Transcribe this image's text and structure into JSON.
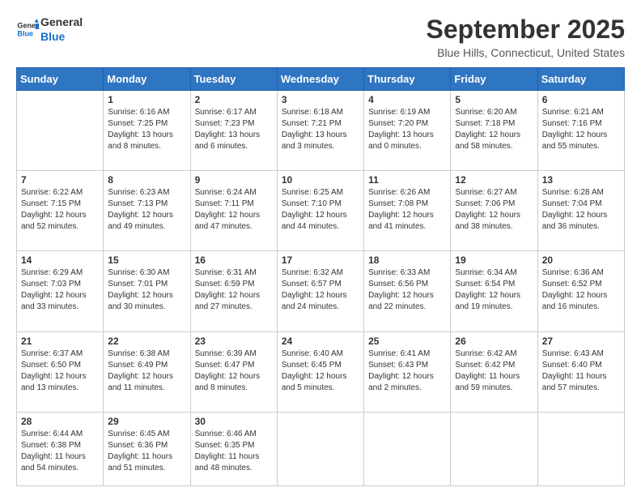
{
  "header": {
    "logo_line1": "General",
    "logo_line2": "Blue",
    "month_title": "September 2025",
    "location": "Blue Hills, Connecticut, United States"
  },
  "weekdays": [
    "Sunday",
    "Monday",
    "Tuesday",
    "Wednesday",
    "Thursday",
    "Friday",
    "Saturday"
  ],
  "weeks": [
    [
      {
        "num": "",
        "sunrise": "",
        "sunset": "",
        "daylight": ""
      },
      {
        "num": "1",
        "sunrise": "Sunrise: 6:16 AM",
        "sunset": "Sunset: 7:25 PM",
        "daylight": "Daylight: 13 hours and 8 minutes."
      },
      {
        "num": "2",
        "sunrise": "Sunrise: 6:17 AM",
        "sunset": "Sunset: 7:23 PM",
        "daylight": "Daylight: 13 hours and 6 minutes."
      },
      {
        "num": "3",
        "sunrise": "Sunrise: 6:18 AM",
        "sunset": "Sunset: 7:21 PM",
        "daylight": "Daylight: 13 hours and 3 minutes."
      },
      {
        "num": "4",
        "sunrise": "Sunrise: 6:19 AM",
        "sunset": "Sunset: 7:20 PM",
        "daylight": "Daylight: 13 hours and 0 minutes."
      },
      {
        "num": "5",
        "sunrise": "Sunrise: 6:20 AM",
        "sunset": "Sunset: 7:18 PM",
        "daylight": "Daylight: 12 hours and 58 minutes."
      },
      {
        "num": "6",
        "sunrise": "Sunrise: 6:21 AM",
        "sunset": "Sunset: 7:16 PM",
        "daylight": "Daylight: 12 hours and 55 minutes."
      }
    ],
    [
      {
        "num": "7",
        "sunrise": "Sunrise: 6:22 AM",
        "sunset": "Sunset: 7:15 PM",
        "daylight": "Daylight: 12 hours and 52 minutes."
      },
      {
        "num": "8",
        "sunrise": "Sunrise: 6:23 AM",
        "sunset": "Sunset: 7:13 PM",
        "daylight": "Daylight: 12 hours and 49 minutes."
      },
      {
        "num": "9",
        "sunrise": "Sunrise: 6:24 AM",
        "sunset": "Sunset: 7:11 PM",
        "daylight": "Daylight: 12 hours and 47 minutes."
      },
      {
        "num": "10",
        "sunrise": "Sunrise: 6:25 AM",
        "sunset": "Sunset: 7:10 PM",
        "daylight": "Daylight: 12 hours and 44 minutes."
      },
      {
        "num": "11",
        "sunrise": "Sunrise: 6:26 AM",
        "sunset": "Sunset: 7:08 PM",
        "daylight": "Daylight: 12 hours and 41 minutes."
      },
      {
        "num": "12",
        "sunrise": "Sunrise: 6:27 AM",
        "sunset": "Sunset: 7:06 PM",
        "daylight": "Daylight: 12 hours and 38 minutes."
      },
      {
        "num": "13",
        "sunrise": "Sunrise: 6:28 AM",
        "sunset": "Sunset: 7:04 PM",
        "daylight": "Daylight: 12 hours and 36 minutes."
      }
    ],
    [
      {
        "num": "14",
        "sunrise": "Sunrise: 6:29 AM",
        "sunset": "Sunset: 7:03 PM",
        "daylight": "Daylight: 12 hours and 33 minutes."
      },
      {
        "num": "15",
        "sunrise": "Sunrise: 6:30 AM",
        "sunset": "Sunset: 7:01 PM",
        "daylight": "Daylight: 12 hours and 30 minutes."
      },
      {
        "num": "16",
        "sunrise": "Sunrise: 6:31 AM",
        "sunset": "Sunset: 6:59 PM",
        "daylight": "Daylight: 12 hours and 27 minutes."
      },
      {
        "num": "17",
        "sunrise": "Sunrise: 6:32 AM",
        "sunset": "Sunset: 6:57 PM",
        "daylight": "Daylight: 12 hours and 24 minutes."
      },
      {
        "num": "18",
        "sunrise": "Sunrise: 6:33 AM",
        "sunset": "Sunset: 6:56 PM",
        "daylight": "Daylight: 12 hours and 22 minutes."
      },
      {
        "num": "19",
        "sunrise": "Sunrise: 6:34 AM",
        "sunset": "Sunset: 6:54 PM",
        "daylight": "Daylight: 12 hours and 19 minutes."
      },
      {
        "num": "20",
        "sunrise": "Sunrise: 6:36 AM",
        "sunset": "Sunset: 6:52 PM",
        "daylight": "Daylight: 12 hours and 16 minutes."
      }
    ],
    [
      {
        "num": "21",
        "sunrise": "Sunrise: 6:37 AM",
        "sunset": "Sunset: 6:50 PM",
        "daylight": "Daylight: 12 hours and 13 minutes."
      },
      {
        "num": "22",
        "sunrise": "Sunrise: 6:38 AM",
        "sunset": "Sunset: 6:49 PM",
        "daylight": "Daylight: 12 hours and 11 minutes."
      },
      {
        "num": "23",
        "sunrise": "Sunrise: 6:39 AM",
        "sunset": "Sunset: 6:47 PM",
        "daylight": "Daylight: 12 hours and 8 minutes."
      },
      {
        "num": "24",
        "sunrise": "Sunrise: 6:40 AM",
        "sunset": "Sunset: 6:45 PM",
        "daylight": "Daylight: 12 hours and 5 minutes."
      },
      {
        "num": "25",
        "sunrise": "Sunrise: 6:41 AM",
        "sunset": "Sunset: 6:43 PM",
        "daylight": "Daylight: 12 hours and 2 minutes."
      },
      {
        "num": "26",
        "sunrise": "Sunrise: 6:42 AM",
        "sunset": "Sunset: 6:42 PM",
        "daylight": "Daylight: 11 hours and 59 minutes."
      },
      {
        "num": "27",
        "sunrise": "Sunrise: 6:43 AM",
        "sunset": "Sunset: 6:40 PM",
        "daylight": "Daylight: 11 hours and 57 minutes."
      }
    ],
    [
      {
        "num": "28",
        "sunrise": "Sunrise: 6:44 AM",
        "sunset": "Sunset: 6:38 PM",
        "daylight": "Daylight: 11 hours and 54 minutes."
      },
      {
        "num": "29",
        "sunrise": "Sunrise: 6:45 AM",
        "sunset": "Sunset: 6:36 PM",
        "daylight": "Daylight: 11 hours and 51 minutes."
      },
      {
        "num": "30",
        "sunrise": "Sunrise: 6:46 AM",
        "sunset": "Sunset: 6:35 PM",
        "daylight": "Daylight: 11 hours and 48 minutes."
      },
      {
        "num": "",
        "sunrise": "",
        "sunset": "",
        "daylight": ""
      },
      {
        "num": "",
        "sunrise": "",
        "sunset": "",
        "daylight": ""
      },
      {
        "num": "",
        "sunrise": "",
        "sunset": "",
        "daylight": ""
      },
      {
        "num": "",
        "sunrise": "",
        "sunset": "",
        "daylight": ""
      }
    ]
  ]
}
